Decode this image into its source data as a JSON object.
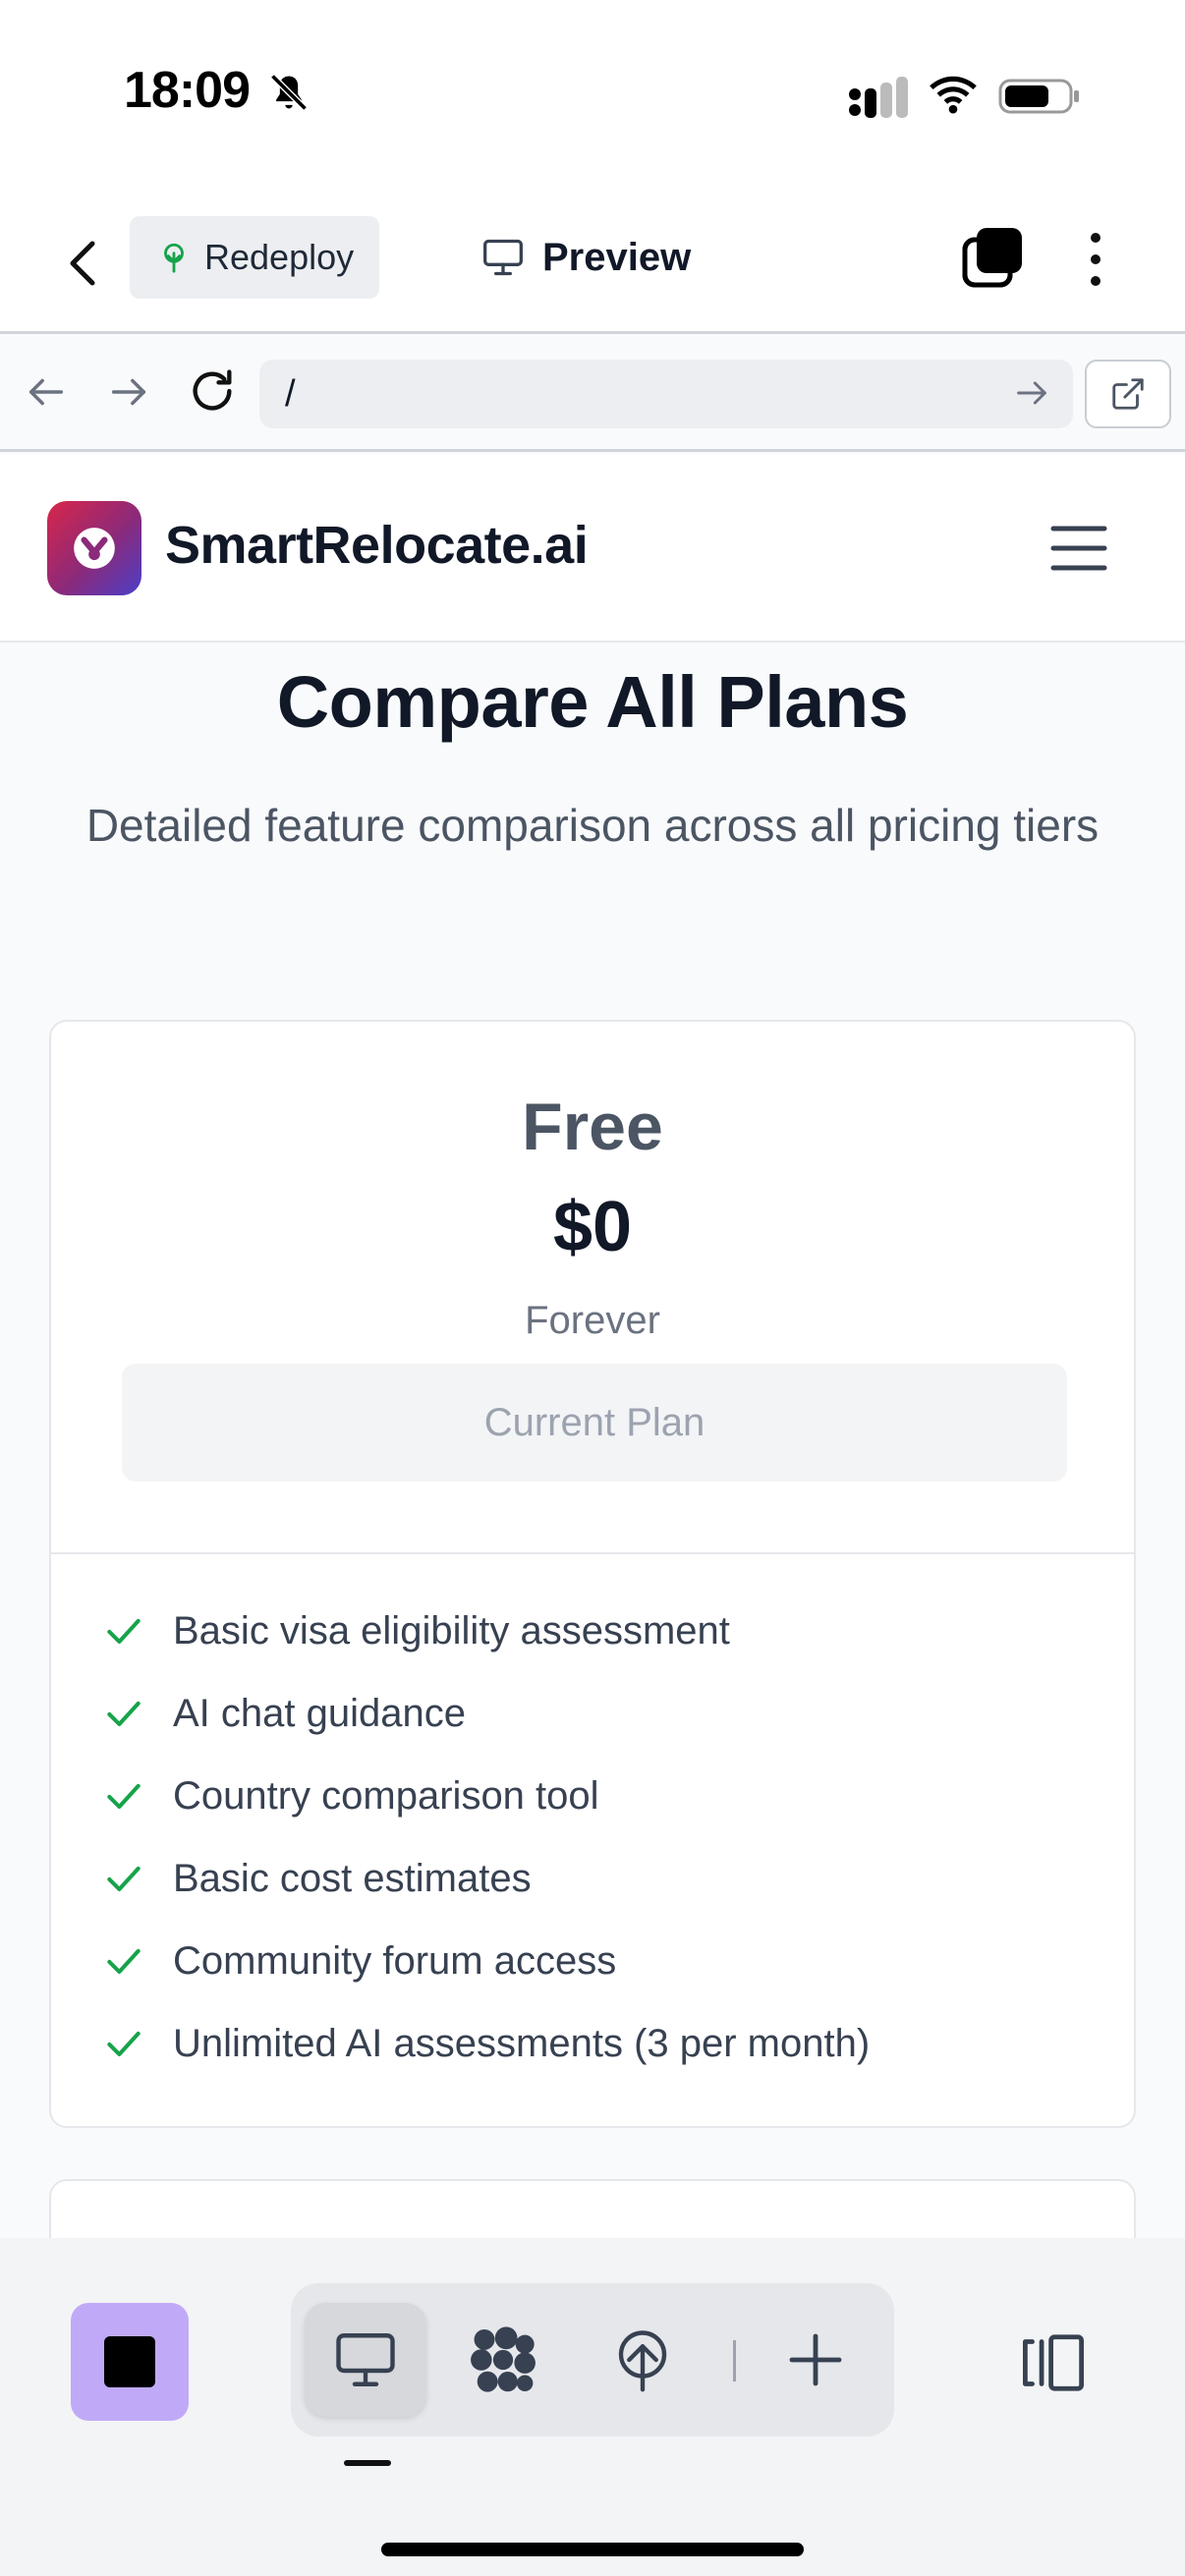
{
  "status_bar": {
    "time": "18:09",
    "icons": [
      "bell-slash-icon",
      "signal-icon",
      "wifi-icon",
      "battery-icon"
    ]
  },
  "toolbar": {
    "redeploy_label": "Redeploy",
    "preview_label": "Preview"
  },
  "browser": {
    "url": "/"
  },
  "site": {
    "brand_name": "SmartRelocate.ai"
  },
  "page": {
    "title": "Compare All Plans",
    "subtitle": "Detailed feature comparison across all pricing tiers"
  },
  "plan": {
    "name": "Free",
    "price": "$0",
    "period": "Forever",
    "button_label": "Current Plan",
    "features": [
      "Basic visa eligibility assessment",
      "AI chat guidance",
      "Country comparison tool",
      "Basic cost estimates",
      "Community forum access",
      "Unlimited AI assessments (3 per month)"
    ]
  },
  "colors": {
    "accent_purple": "#c0aaf7",
    "check_green": "#16a34a",
    "logo_gradient": [
      "#d8264a",
      "#4b3fc8"
    ]
  }
}
